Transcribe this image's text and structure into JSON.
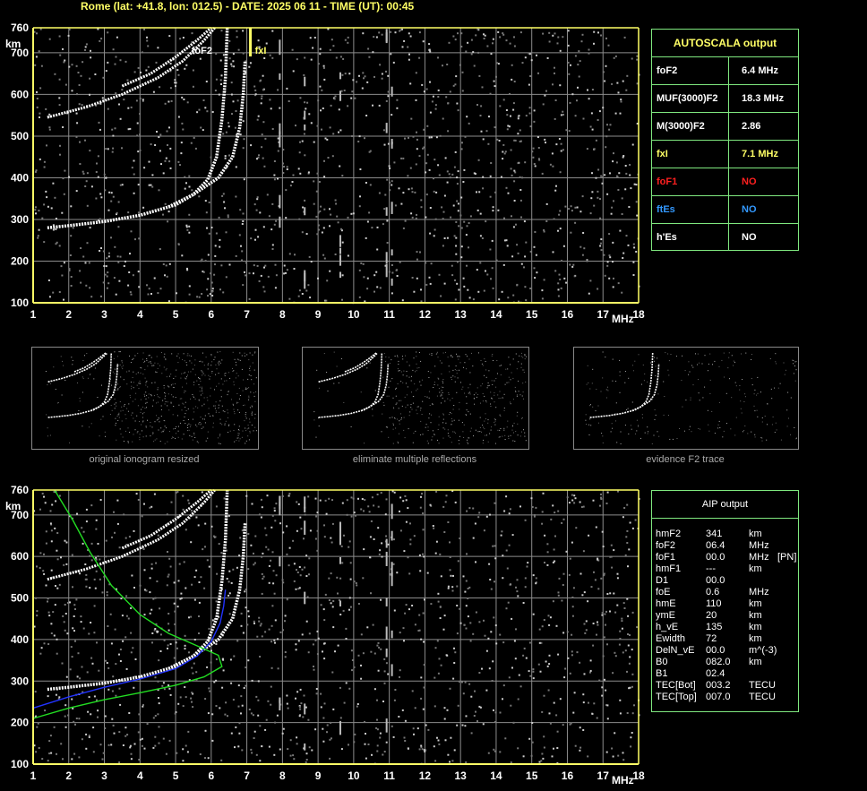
{
  "header": {
    "text": "Rome (lat: +41.8, lon: 012.5) - DATE: 2025 06 11 - TIME (UT): 00:45"
  },
  "colors": {
    "axis": "#ffff66",
    "grid": "#8c8c8c",
    "panel_border": "#7fe87f",
    "trace": "#ffffff",
    "aip_profile": "#2233ff",
    "model_profile": "#22dd22"
  },
  "chart_data": [
    {
      "type": "scatter",
      "panel": "top-ionogram",
      "ylabel": "km",
      "xlabel": "MHz",
      "xlim": [
        1,
        18
      ],
      "ylim": [
        100,
        760
      ],
      "x_ticks": [
        1,
        2,
        3,
        4,
        5,
        6,
        7,
        8,
        9,
        10,
        11,
        12,
        13,
        14,
        15,
        16,
        17,
        18
      ],
      "y_ticks": [
        100,
        200,
        300,
        400,
        500,
        600,
        700,
        760
      ],
      "annotations": [
        {
          "text": "foF2",
          "x": 6.4
        },
        {
          "text": "fxI",
          "x": 7.1
        }
      ],
      "series": [
        {
          "role": "o-trace",
          "points": [
            [
              1.4,
              280
            ],
            [
              2,
              285
            ],
            [
              3,
              295
            ],
            [
              4,
              310
            ],
            [
              5,
              335
            ],
            [
              5.5,
              360
            ],
            [
              5.9,
              395
            ],
            [
              6.15,
              450
            ],
            [
              6.3,
              540
            ],
            [
              6.4,
              640
            ],
            [
              6.45,
              760
            ]
          ]
        },
        {
          "role": "x-trace",
          "points": [
            [
              4.8,
              330
            ],
            [
              5.5,
              360
            ],
            [
              6.2,
              400
            ],
            [
              6.6,
              450
            ],
            [
              6.8,
              520
            ],
            [
              6.9,
              600
            ],
            [
              6.95,
              680
            ]
          ]
        },
        {
          "role": "o-echo",
          "points": [
            [
              1.4,
              545
            ],
            [
              2.5,
              570
            ],
            [
              3.5,
              600
            ],
            [
              4.5,
              640
            ],
            [
              5.2,
              680
            ],
            [
              5.8,
              730
            ],
            [
              6.1,
              760
            ]
          ]
        },
        {
          "role": "x-echo",
          "points": [
            [
              3.5,
              620
            ],
            [
              4.3,
              650
            ],
            [
              5,
              690
            ],
            [
              5.6,
              730
            ],
            [
              6,
              760
            ]
          ]
        }
      ]
    },
    {
      "type": "scatter",
      "panel": "bottom-ionogram",
      "ylabel": "km",
      "xlabel": "MHz",
      "xlim": [
        1,
        18
      ],
      "ylim": [
        100,
        760
      ],
      "x_ticks": [
        1,
        2,
        3,
        4,
        5,
        6,
        7,
        8,
        9,
        10,
        11,
        12,
        13,
        14,
        15,
        16,
        17,
        18
      ],
      "y_ticks": [
        100,
        200,
        300,
        400,
        500,
        600,
        700,
        760
      ],
      "series": [
        {
          "role": "o-trace",
          "points": [
            [
              1.4,
              280
            ],
            [
              2,
              285
            ],
            [
              3,
              295
            ],
            [
              4,
              310
            ],
            [
              5,
              335
            ],
            [
              5.5,
              360
            ],
            [
              5.9,
              395
            ],
            [
              6.15,
              450
            ],
            [
              6.3,
              540
            ],
            [
              6.4,
              640
            ],
            [
              6.45,
              760
            ]
          ]
        },
        {
          "role": "x-trace",
          "points": [
            [
              4.8,
              330
            ],
            [
              5.5,
              360
            ],
            [
              6.2,
              400
            ],
            [
              6.6,
              450
            ],
            [
              6.8,
              520
            ],
            [
              6.9,
              600
            ],
            [
              6.95,
              680
            ]
          ]
        },
        {
          "role": "o-echo",
          "points": [
            [
              1.4,
              545
            ],
            [
              2.5,
              570
            ],
            [
              3.5,
              600
            ],
            [
              4.5,
              640
            ],
            [
              5.2,
              680
            ],
            [
              5.8,
              730
            ],
            [
              6.1,
              760
            ]
          ]
        },
        {
          "role": "x-echo",
          "points": [
            [
              3.5,
              620
            ],
            [
              4.3,
              650
            ],
            [
              5,
              690
            ],
            [
              5.6,
              730
            ],
            [
              6,
              760
            ]
          ]
        },
        {
          "role": "aip-profile",
          "points": [
            [
              1,
              235
            ],
            [
              2,
              262
            ],
            [
              3,
              285
            ],
            [
              4,
              305
            ],
            [
              5,
              330
            ],
            [
              5.6,
              360
            ],
            [
              6.0,
              395
            ],
            [
              6.25,
              440
            ],
            [
              6.35,
              480
            ],
            [
              6.4,
              520
            ]
          ]
        },
        {
          "role": "model-profile",
          "points": [
            [
              1,
              210
            ],
            [
              2,
              235
            ],
            [
              3,
              255
            ],
            [
              4,
              272
            ],
            [
              5,
              290
            ],
            [
              5.8,
              310
            ],
            [
              6.3,
              335
            ],
            [
              6.2,
              362
            ],
            [
              5.6,
              385
            ],
            [
              4.8,
              415
            ],
            [
              4,
              460
            ],
            [
              3.2,
              530
            ],
            [
              2.6,
              610
            ],
            [
              2.1,
              690
            ],
            [
              1.6,
              760
            ]
          ]
        }
      ]
    }
  ],
  "autoscala": {
    "title": "AUTOSCALA output",
    "rows": [
      {
        "key": "foF2",
        "value": "6.4 MHz",
        "key_color": "#ffffff",
        "value_color": "#ffffff"
      },
      {
        "key": "MUF(3000)F2",
        "value": "18.3 MHz",
        "key_color": "#ffffff",
        "value_color": "#ffffff"
      },
      {
        "key": "M(3000)F2",
        "value": "2.86",
        "key_color": "#ffffff",
        "value_color": "#ffffff"
      },
      {
        "key": "fxI",
        "value": "7.1 MHz",
        "key_color": "#ffff66",
        "value_color": "#ffff66"
      },
      {
        "key": "foF1",
        "value": "NO",
        "key_color": "#ff2020",
        "value_color": "#ff2020"
      },
      {
        "key": "ftEs",
        "value": "NO",
        "key_color": "#3399ff",
        "value_color": "#3399ff"
      },
      {
        "key": "h'Es",
        "value": "NO",
        "key_color": "#ffffff",
        "value_color": "#ffffff"
      }
    ]
  },
  "aip": {
    "title": "AIP output",
    "rows": [
      {
        "k": "hmF2",
        "v": "341",
        "u": "km",
        "x": ""
      },
      {
        "k": "foF2",
        "v": "06.4",
        "u": "MHz",
        "x": ""
      },
      {
        "k": "foF1",
        "v": "00.0",
        "u": "MHz",
        "x": "[PN]"
      },
      {
        "k": "hmF1",
        "v": "---",
        "u": "km",
        "x": ""
      },
      {
        "k": "D1",
        "v": "00.0",
        "u": "",
        "x": ""
      },
      {
        "k": "foE",
        "v": "0.6",
        "u": "MHz",
        "x": ""
      },
      {
        "k": "hmE",
        "v": "110",
        "u": "km",
        "x": ""
      },
      {
        "k": "ymE",
        "v": "20",
        "u": "km",
        "x": ""
      },
      {
        "k": "h_vE",
        "v": "135",
        "u": "km",
        "x": ""
      },
      {
        "k": "Ewidth",
        "v": "72",
        "u": "km",
        "x": ""
      },
      {
        "k": "DelN_vE",
        "v": "00.0",
        "u": "m^(-3)",
        "x": ""
      },
      {
        "k": "B0",
        "v": "082.0",
        "u": "km",
        "x": ""
      },
      {
        "k": "B1",
        "v": "02.4",
        "u": "",
        "x": ""
      },
      {
        "k": "TEC[Bot]",
        "v": "003.2",
        "u": "TECU",
        "x": ""
      },
      {
        "k": "TEC[Top]",
        "v": "007.0",
        "u": "TECU",
        "x": ""
      }
    ]
  },
  "thumbnails": [
    {
      "caption": "original ionogram resized"
    },
    {
      "caption": "eliminate multiple reflections"
    },
    {
      "caption": "evidence F2 trace"
    }
  ]
}
